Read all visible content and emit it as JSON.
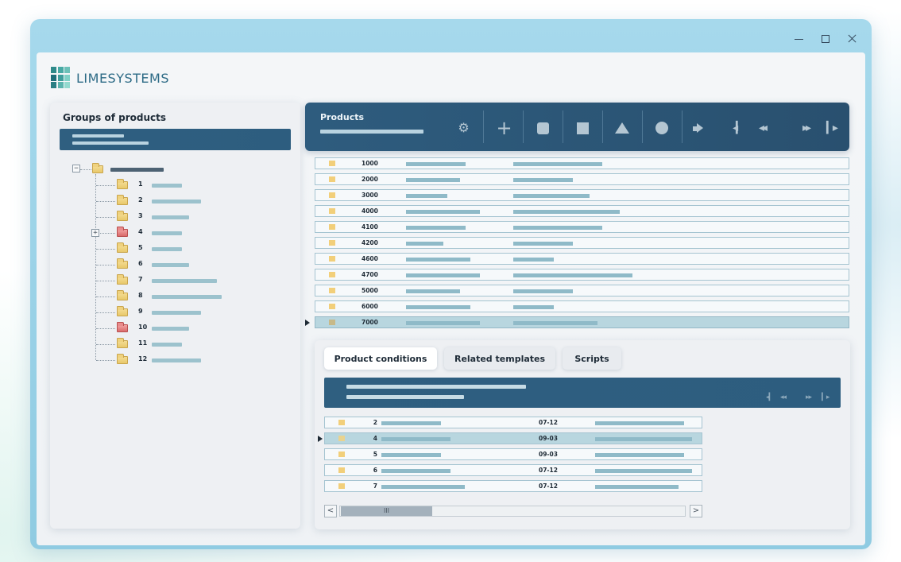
{
  "brand": {
    "logo_text_a": "LIME",
    "logo_text_b": "SYSTEMS",
    "logo_colors": [
      "#2e8a8a",
      "#47a9a4",
      "#6cc0b8",
      "#1f6f7a",
      "#3f9e9c",
      "#7fd0c6",
      "#2a7f84",
      "#5bb4ae",
      "#93dacf"
    ]
  },
  "window_controls": {
    "minimize_icon": "minimize-icon",
    "maximize_icon": "maximize-icon",
    "close_icon": "close-icon"
  },
  "left_panel": {
    "title": "Groups of products",
    "tree": {
      "items": [
        {
          "label": "1",
          "folder": "yellow",
          "expandable": false
        },
        {
          "label": "2",
          "folder": "yellow",
          "expandable": false
        },
        {
          "label": "3",
          "folder": "yellow",
          "expandable": false
        },
        {
          "label": "4",
          "folder": "red",
          "expandable": true
        },
        {
          "label": "5",
          "folder": "yellow",
          "expandable": false
        },
        {
          "label": "6",
          "folder": "yellow",
          "expandable": false
        },
        {
          "label": "7",
          "folder": "yellow",
          "expandable": false
        },
        {
          "label": "8",
          "folder": "yellow",
          "expandable": false
        },
        {
          "label": "9",
          "folder": "yellow",
          "expandable": false
        },
        {
          "label": "10",
          "folder": "red",
          "expandable": false
        },
        {
          "label": "11",
          "folder": "yellow",
          "expandable": false
        },
        {
          "label": "12",
          "folder": "yellow",
          "expandable": false
        }
      ],
      "collapse_symbol": "−",
      "expand_symbol": "+"
    }
  },
  "products": {
    "title": "Products",
    "toolbar_icons": [
      "gear-icon",
      "plus-icon",
      "rounded-square-icon",
      "square-icon",
      "triangle-icon",
      "circle-icon",
      "arrow-right-icon",
      "first-page-icon",
      "previous-page-icon",
      "next-page-icon",
      "last-page-icon"
    ],
    "rows": [
      {
        "code": "1000",
        "selected": false
      },
      {
        "code": "2000",
        "selected": false
      },
      {
        "code": "3000",
        "selected": false
      },
      {
        "code": "4000",
        "selected": false
      },
      {
        "code": "4100",
        "selected": false
      },
      {
        "code": "4200",
        "selected": false
      },
      {
        "code": "4600",
        "selected": false
      },
      {
        "code": "4700",
        "selected": false
      },
      {
        "code": "5000",
        "selected": false
      },
      {
        "code": "6000",
        "selected": false
      },
      {
        "code": "7000",
        "selected": true
      }
    ]
  },
  "tabs": {
    "items": [
      {
        "label": "Product conditions",
        "active": true
      },
      {
        "label": "Related templates",
        "active": false
      },
      {
        "label": "Scripts",
        "active": false
      }
    ]
  },
  "conditions": {
    "rows": [
      {
        "num": "2",
        "date": "07-12",
        "selected": false
      },
      {
        "num": "4",
        "date": "09-03",
        "selected": true
      },
      {
        "num": "5",
        "date": "09-03",
        "selected": false
      },
      {
        "num": "6",
        "date": "07-12",
        "selected": false
      },
      {
        "num": "7",
        "date": "07-12",
        "selected": false
      }
    ]
  },
  "scrollbar": {
    "left_arrow": "<",
    "right_arrow": ">",
    "thumb_grip": "III"
  },
  "colors": {
    "accent_dark": "#2e5c7e",
    "row_border": "#a5c4d1",
    "selected_row": "#b8d6df",
    "folder_yellow": "#f2cf7a",
    "folder_red": "#d96a6a"
  }
}
